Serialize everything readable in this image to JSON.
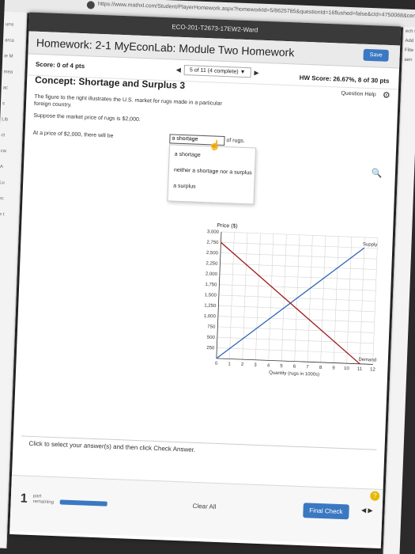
{
  "browser": {
    "url": "https://www.mathxl.com/Student/PlayerHomework.aspx?homeworkId=5/8625785&questionId=16flushed=false&cId=4750068&centerwin=yes"
  },
  "side_left": [
    "urre",
    "arca",
    "ie M",
    "mea",
    "ac",
    "s",
    "Lib",
    "ct",
    "cw",
    "A",
    "Lu",
    "ec",
    "le t",
    "c"
  ],
  "side_right": [
    "ech F",
    "Add",
    "Filte",
    "aen"
  ],
  "window": {
    "title": "ECO-201-T2673-17EW2-Ward",
    "homework_title": "Homework: 2-1 MyEconLab: Module Two Homework",
    "save_label": "Save",
    "score": "Score: 0 of 4 pts",
    "prev_icon": "◀",
    "counter": "5 of 11 (4 complete) ▼",
    "next_icon": "▶",
    "hw_score": "HW Score: 26.67%, 8 of 30 pts",
    "question_title": "Concept: Shortage and Surplus 3",
    "question_help": "Question Help",
    "gear_icon": "⚙"
  },
  "question": {
    "line1": "The figure to the right illustrates the U.S. market for rugs made in a particular",
    "line2": "foreign country.",
    "line3": "Suppose the market price of rugs is $2,000.",
    "line4_pre": "At a price of $2,000, there will be",
    "dropdown_value": "a shortage",
    "of_rugs": "of rugs.",
    "options": [
      "a shortage",
      "neither a shortage nor a surplus",
      "a surplus"
    ]
  },
  "chart_data": {
    "type": "line",
    "ylabel": "Price ($)",
    "xlabel": "Quantity (rugs in 1000s)",
    "ylim": [
      0,
      3000
    ],
    "xlim": [
      0,
      12
    ],
    "yticks": [
      "250",
      "500",
      "750",
      "1,000",
      "1,250",
      "1,500",
      "1,750",
      "2,000",
      "2,250",
      "2,500",
      "2,750",
      "3,000"
    ],
    "xticks": [
      "0",
      "1",
      "2",
      "3",
      "4",
      "5",
      "6",
      "7",
      "8",
      "9",
      "10",
      "11",
      "12"
    ],
    "series": [
      {
        "name": "Supply",
        "points": [
          [
            0,
            0
          ],
          [
            11,
            2750
          ]
        ]
      },
      {
        "name": "Demand",
        "points": [
          [
            0,
            2750
          ],
          [
            11,
            0
          ]
        ]
      }
    ],
    "colors": {
      "Supply": "#2f63b8",
      "Demand": "#a01818"
    }
  },
  "instructions": "Click to select your answer(s) and then click Check Answer.",
  "footer": {
    "part_num": "1",
    "part_label1": "part",
    "part_label2": "remaining",
    "clear_all": "Clear All",
    "final_check": "Final Check",
    "arrows": "◀ ▶",
    "help": "?"
  }
}
